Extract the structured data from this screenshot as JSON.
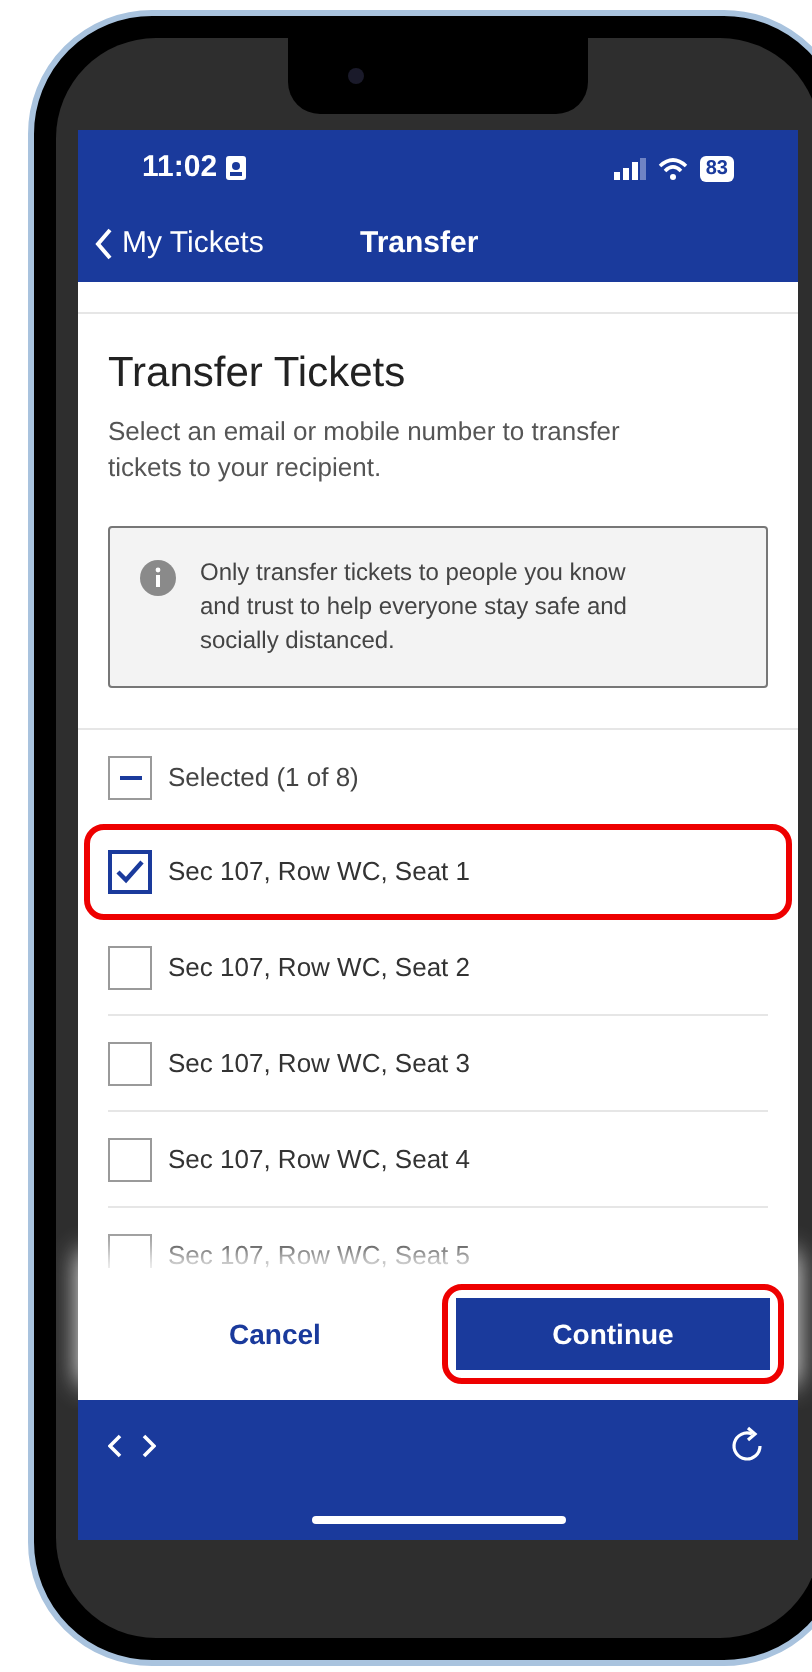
{
  "status_bar": {
    "time": "11:02",
    "battery": "83"
  },
  "nav": {
    "back": "My Tickets",
    "title": "Transfer"
  },
  "heading": "Transfer Tickets",
  "description": "Select an email or mobile number to transfer tickets to your recipient.",
  "notice": "Only transfer tickets to people you know and trust to help everyone stay safe and socially distanced.",
  "select_all": {
    "label": "Selected (1 of 8)",
    "partial": true
  },
  "tickets": [
    {
      "label": "Sec 107, Row WC, Seat 1",
      "checked": true,
      "highlighted": true
    },
    {
      "label": "Sec 107, Row WC, Seat 2",
      "checked": false,
      "highlighted": false
    },
    {
      "label": "Sec 107, Row WC, Seat 3",
      "checked": false,
      "highlighted": false
    },
    {
      "label": "Sec 107, Row WC, Seat 4",
      "checked": false,
      "highlighted": false
    },
    {
      "label": "Sec 107, Row WC, Seat 5",
      "checked": false,
      "highlighted": false
    }
  ],
  "actions": {
    "cancel": "Cancel",
    "continue": "Continue",
    "continue_highlighted": true
  }
}
